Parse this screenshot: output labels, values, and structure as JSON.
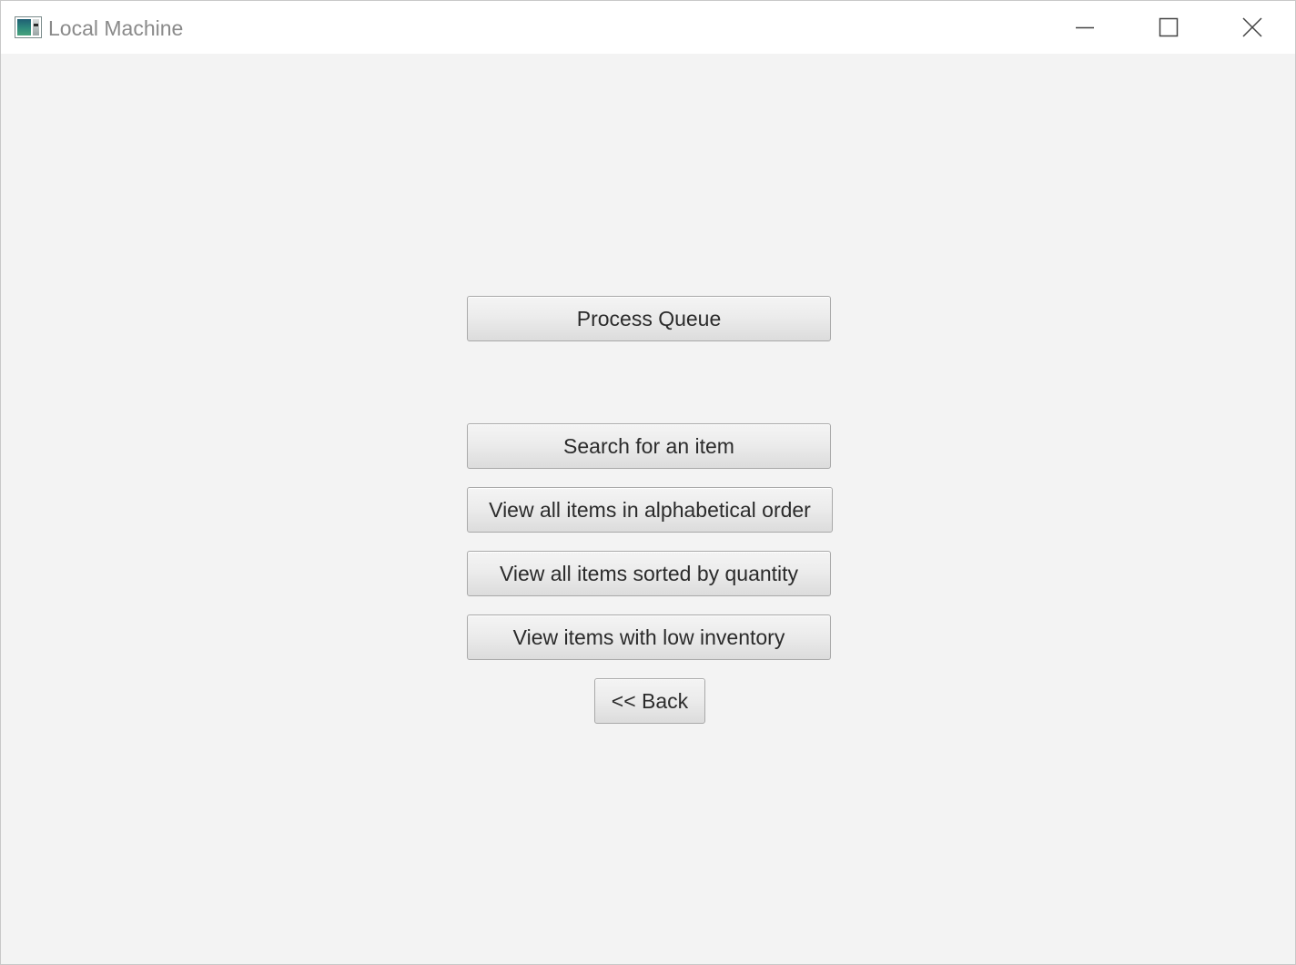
{
  "window": {
    "title": "Local Machine",
    "controls": {
      "minimize_icon": "minimize-icon",
      "maximize_icon": "maximize-icon",
      "close_icon": "close-icon"
    }
  },
  "menu": {
    "process_queue": "Process Queue",
    "search_item": "Search for an item",
    "view_alphabetical": "View all items in alphabetical order",
    "view_by_quantity": "View all items sorted by quantity",
    "view_low_inventory": "View items with low inventory",
    "back": "<< Back"
  },
  "colors": {
    "background": "#f3f3f3",
    "titlebar": "#ffffff",
    "button_border": "#a9a9a9",
    "button_text": "#2b2b2b",
    "title_text": "#8a8a8a"
  }
}
